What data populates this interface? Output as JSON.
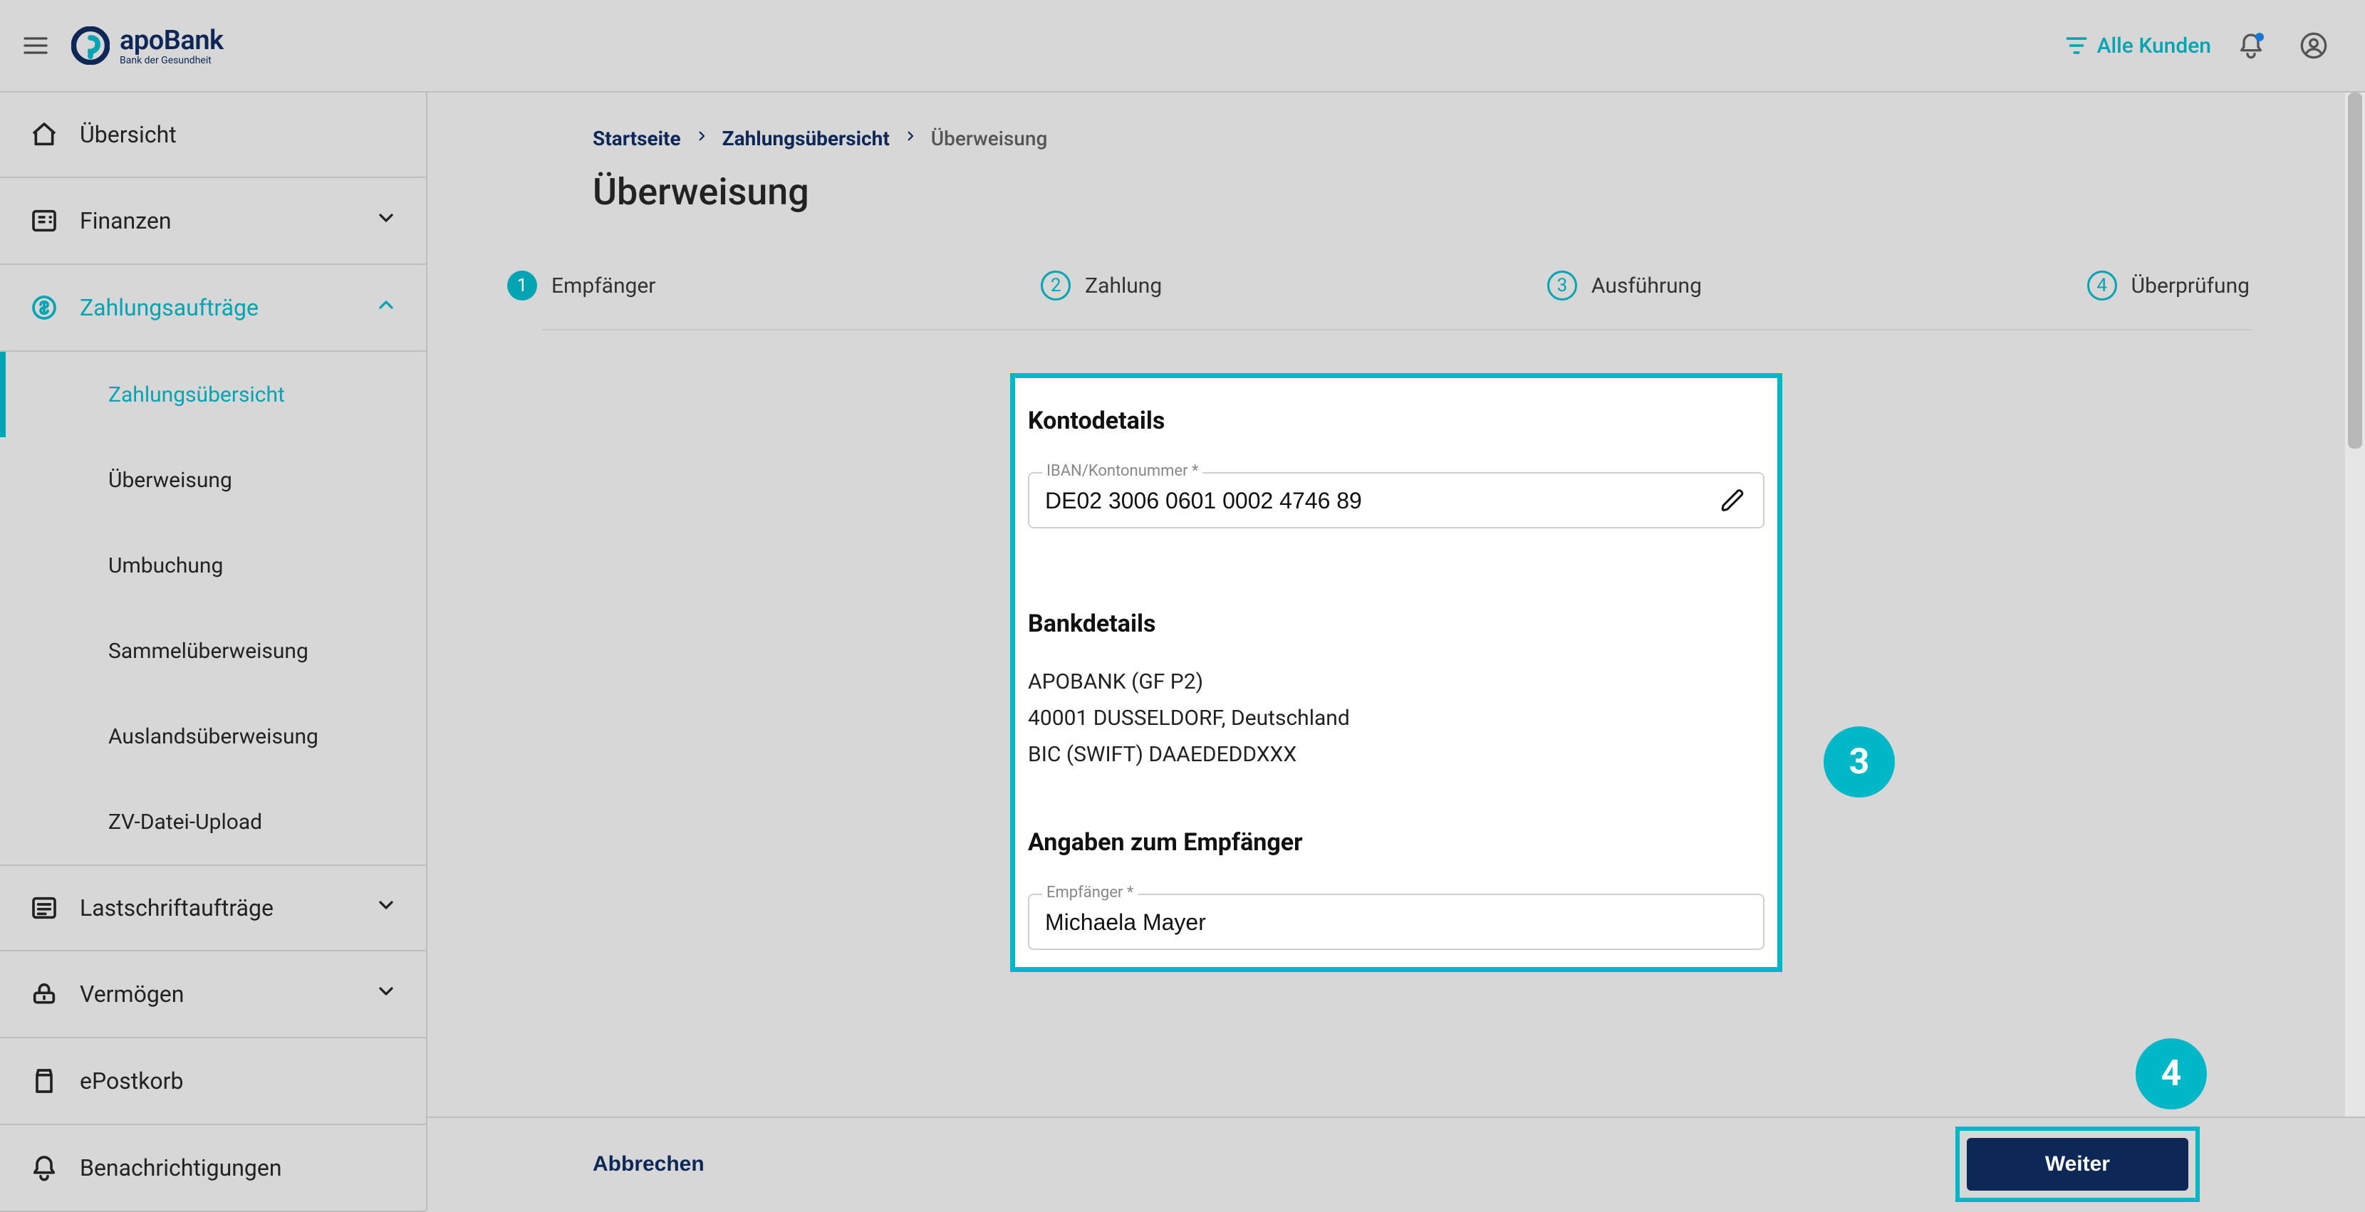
{
  "brand": {
    "name": "apoBank",
    "tagline": "Bank der Gesundheit"
  },
  "top": {
    "filter": "Alle Kunden"
  },
  "nav": {
    "items": [
      {
        "icon": "home",
        "label": "Übersicht"
      },
      {
        "icon": "finance",
        "label": "Finanzen",
        "expandable": true
      },
      {
        "icon": "payments",
        "label": "Zahlungsaufträge",
        "expandable": true,
        "expanded": true,
        "active": true
      },
      {
        "icon": "debits",
        "label": "Lastschriftaufträge",
        "expandable": true
      },
      {
        "icon": "wealth",
        "label": "Vermögen",
        "expandable": true
      },
      {
        "icon": "mail",
        "label": "ePostkorb"
      },
      {
        "icon": "bell",
        "label": "Benachrichtigungen"
      }
    ],
    "payments_sub": [
      "Zahlungsübersicht",
      "Überweisung",
      "Umbuchung",
      "Sammelüberweisung",
      "Auslandsüberweisung",
      "ZV-Datei-Upload"
    ],
    "active_sub": "Zahlungsübersicht"
  },
  "breadcrumb": {
    "items": [
      "Startseite",
      "Zahlungsübersicht"
    ],
    "current": "Überweisung"
  },
  "page": {
    "title": "Überweisung"
  },
  "steps": [
    {
      "n": "1",
      "label": "Empfänger",
      "state": "current"
    },
    {
      "n": "2",
      "label": "Zahlung"
    },
    {
      "n": "3",
      "label": "Ausführung"
    },
    {
      "n": "4",
      "label": "Überprüfung"
    }
  ],
  "form": {
    "konto": {
      "title": "Kontodetails",
      "iban_label": "IBAN/Kontonummer *",
      "iban_value": "DE02 3006 0601 0002 4746 89"
    },
    "bank": {
      "title": "Bankdetails",
      "line1": "APOBANK (GF P2)",
      "line2": "40001 DUSSELDORF, Deutschland",
      "line3": "BIC (SWIFT)  DAAEDEDDXXX"
    },
    "recipient": {
      "title": "Angaben zum Empfänger",
      "label": "Empfänger *",
      "value": "Michaela Mayer"
    }
  },
  "footer": {
    "cancel": "Abbrechen",
    "next": "Weiter"
  },
  "callouts": {
    "c3": "3",
    "c4": "4"
  }
}
